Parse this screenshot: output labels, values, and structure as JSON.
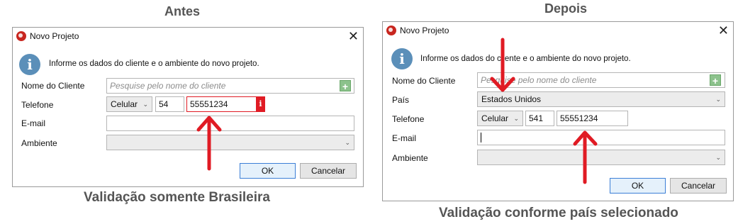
{
  "left": {
    "heading": "Antes",
    "caption": "Validação somente Brasileira",
    "dialog": {
      "title": "Novo Projeto",
      "close": "✕",
      "info": "Informe os dados do cliente e o ambiente do novo projeto.",
      "labels": {
        "client": "Nome do Cliente",
        "phone": "Telefone",
        "email": "E-mail",
        "env": "Ambiente"
      },
      "client_placeholder": "Pesquise pelo nome do cliente",
      "phone_type": "Celular",
      "area_code": "54",
      "phone_number": "55551234",
      "error_badge": "i",
      "email_value": "",
      "ok": "OK",
      "cancel": "Cancelar"
    }
  },
  "right": {
    "heading": "Depois",
    "caption": "Validação conforme país selecionado",
    "dialog": {
      "title": "Novo Projeto",
      "close": "✕",
      "info": "Informe os dados do cliente e o ambiente do novo projeto.",
      "labels": {
        "client": "Nome do Cliente",
        "country": "País",
        "phone": "Telefone",
        "email": "E-mail",
        "env": "Ambiente"
      },
      "client_placeholder": "Pesquise pelo nome do cliente",
      "country_value": "Estados Unidos",
      "phone_type": "Celular",
      "area_code": "541",
      "phone_number": "55551234",
      "email_value": "",
      "ok": "OK",
      "cancel": "Cancelar"
    }
  },
  "icons": {
    "app": "app-logo-icon",
    "info": "info-icon",
    "plus": "plus-icon",
    "dropdown": "chevron-down-icon",
    "arrow": "red-arrow-icon"
  },
  "colors": {
    "arrow": "#e01b24",
    "error": "#e01b24",
    "info": "#5b8fb9",
    "heading": "#555555"
  }
}
